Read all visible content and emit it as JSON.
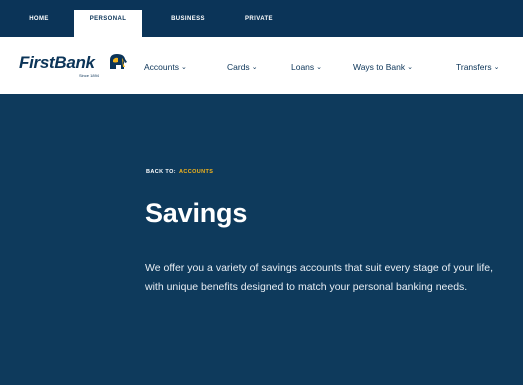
{
  "topbar": {
    "tabs": [
      {
        "label": "Home"
      },
      {
        "label": "Personal"
      },
      {
        "label": "Business"
      },
      {
        "label": "Private"
      }
    ]
  },
  "brand": {
    "name": "FirstBank",
    "since": "Since 1894",
    "colors": {
      "navy": "#0b3458",
      "hero": "#0e3a5c",
      "accent": "#f5b51b"
    }
  },
  "nav": {
    "items": [
      {
        "label": "Accounts",
        "icon": "chevron-down-icon"
      },
      {
        "label": "Cards",
        "icon": "chevron-down-icon"
      },
      {
        "label": "Loans",
        "icon": "chevron-down-icon"
      },
      {
        "label": "Ways to Bank",
        "icon": "chevron-down-icon"
      },
      {
        "label": "Transfers",
        "icon": "chevron-down-icon"
      }
    ]
  },
  "hero": {
    "breadcrumb_prefix": "Back to:",
    "breadcrumb_link": "Accounts",
    "title": "Savings",
    "description": "We offer you a variety of savings accounts that suit every stage of your life, with unique benefits designed to match your personal banking needs."
  }
}
